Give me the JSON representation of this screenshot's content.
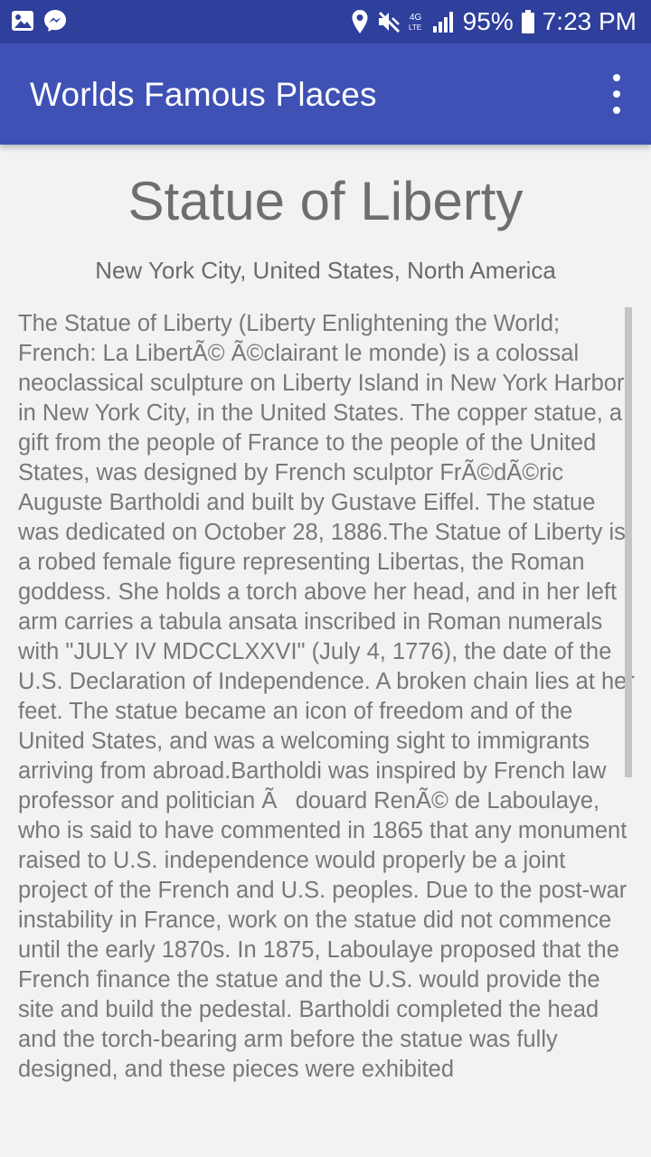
{
  "status_bar": {
    "battery": "95%",
    "time": "7:23 PM",
    "icons": [
      "gallery-icon",
      "messenger-icon",
      "location-icon",
      "mute-icon",
      "lte-icon",
      "signal-icon",
      "battery-icon"
    ]
  },
  "app_bar": {
    "title": "Worlds Famous Places",
    "color": "#3f51b5"
  },
  "place": {
    "name": "Statue of Liberty",
    "location": "New York City, United States, North America",
    "description": "The Statue of Liberty (Liberty Enlightening the World; French: La LibertÃ© Ã©clairant le monde) is a colossal neoclassical sculpture on Liberty Island in New York Harbor in New York City, in the United States. The copper statue, a gift from the people of France to the people of the United States, was designed by French sculptor FrÃ©dÃ©ric Auguste Bartholdi and built by Gustave Eiffel. The statue was dedicated on October 28, 1886.The Statue of Liberty is a robed female figure representing Libertas, the Roman goddess. She holds a torch above her head, and in her left arm carries a tabula ansata inscribed in Roman numerals with \"JULY IV MDCCLXXVI\" (July 4, 1776), the date of the U.S. Declaration of Independence. A broken chain lies at her feet. The statue became an icon of freedom and of the United States, and was a welcoming sight to immigrants arriving from abroad.Bartholdi was inspired by French law professor and politician Ãdouard RenÃ© de Laboulaye, who is said to have commented in 1865 that any monument raised to U.S. independence would properly be a joint project of the French and U.S. peoples. Due to the post-war instability in France, work on the statue did not commence until the early 1870s. In 1875, Laboulaye proposed that the French finance the statue and the U.S. would provide the site and build the pedestal. Bartholdi completed the head and the torch-bearing arm before the statue was fully designed, and these pieces were exhibited"
  }
}
